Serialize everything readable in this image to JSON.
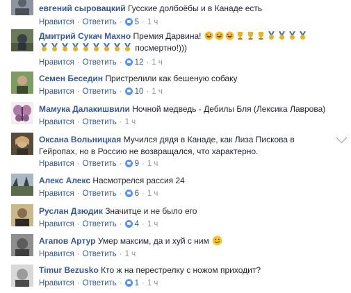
{
  "actions": {
    "like": "Нравится",
    "reply": "Ответить",
    "sep": "·"
  },
  "comments": [
    {
      "author": "евгений сыровацкий",
      "text": "Гусские долбоёбы и в Канаде есть",
      "likes": "5",
      "time": "1 ч"
    },
    {
      "author": "Дмитрий Сукач Махно",
      "text": "Премия Дарвина!",
      "text_end": "посмертно!)))",
      "likes": "12",
      "time": "1 ч"
    },
    {
      "author": "Семен Беседин",
      "text": "Пристрелили как бешеную собаку",
      "likes": "10",
      "time": "1 ч"
    },
    {
      "author": "Мамука Далакишвили",
      "text": "Ночной медведь - Дебилы Бля (Лексика Лаврова)",
      "likes": "",
      "time": "1 ч"
    },
    {
      "author": "Оксана Вольницкая",
      "text": "Мучился дядя в Канаде, как Лиза Пискова в Гейропах, но в Россию не возвращался, что характерно.",
      "likes": "9",
      "time": "1 ч"
    },
    {
      "author": "Алекс Алекс",
      "text": "Насмотрелся рассия 24",
      "likes": "6",
      "time": "1 ч"
    },
    {
      "author": "Руслан Дзюдик",
      "text": "Значитце и не было его",
      "likes": "4",
      "time": "1 ч"
    },
    {
      "author": "Агапов Артур",
      "text": "Умер максим, да и хуй с ним",
      "likes": "",
      "time": "1 ч"
    },
    {
      "author": "Timur Bezusko",
      "text": "Кто ж на перестрелку с ножом приходит?",
      "likes": "1",
      "time": "1 ч"
    }
  ],
  "icons": {
    "like": "like-icon",
    "laugh": "laughing-emoji",
    "trophy": "trophy-emoji",
    "medal": "medal-emoji",
    "smile": "smile-emoji"
  },
  "colors": {
    "link": "#365899",
    "meta": "#90949c",
    "like_icon": "#5890ff"
  }
}
